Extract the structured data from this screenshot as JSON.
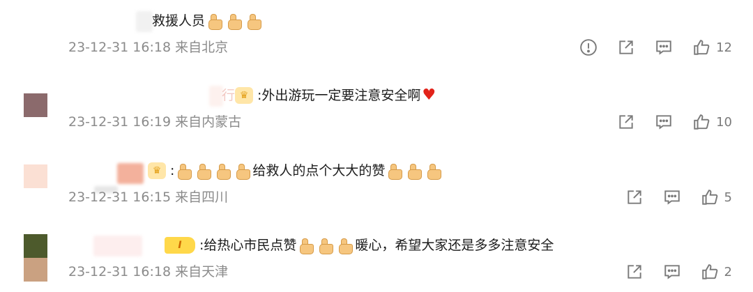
{
  "comments": [
    {
      "text": "救援人员",
      "thumbs": 3,
      "meta": "23-12-31 16:18 来自北京",
      "like_count": "12",
      "report_icon": "alert-circle-icon",
      "share_icon": "share-icon",
      "reply_icon": "comment-icon",
      "like_icon": "thumbs-up-icon"
    },
    {
      "name_fragment": "行",
      "text": ":外出游玩一定要注意安全啊",
      "meta": "23-12-31 16:19 来自内蒙古",
      "like_count": "10",
      "avatar_color": "#8b6a6c"
    },
    {
      "text_before": ":",
      "text_after": "给救人的点个大大的赞",
      "meta": "23-12-31 16:15 来自四川",
      "like_count": "5",
      "avatar_color": "#fbe0d4"
    },
    {
      "badge_label": "I",
      "text": ":给热心市民点赞",
      "text_after": "暖心，希望大家还是多多注意安全",
      "meta": "23-12-31 16:18 来自天津",
      "like_count": "2",
      "avatar_color_top": "#4d5a2c",
      "avatar_color_bottom": "#caa181"
    }
  ],
  "colors": {
    "meta_text": "#8b8b8b",
    "heart": "#e2231a",
    "thumb": "#f6c67f"
  }
}
